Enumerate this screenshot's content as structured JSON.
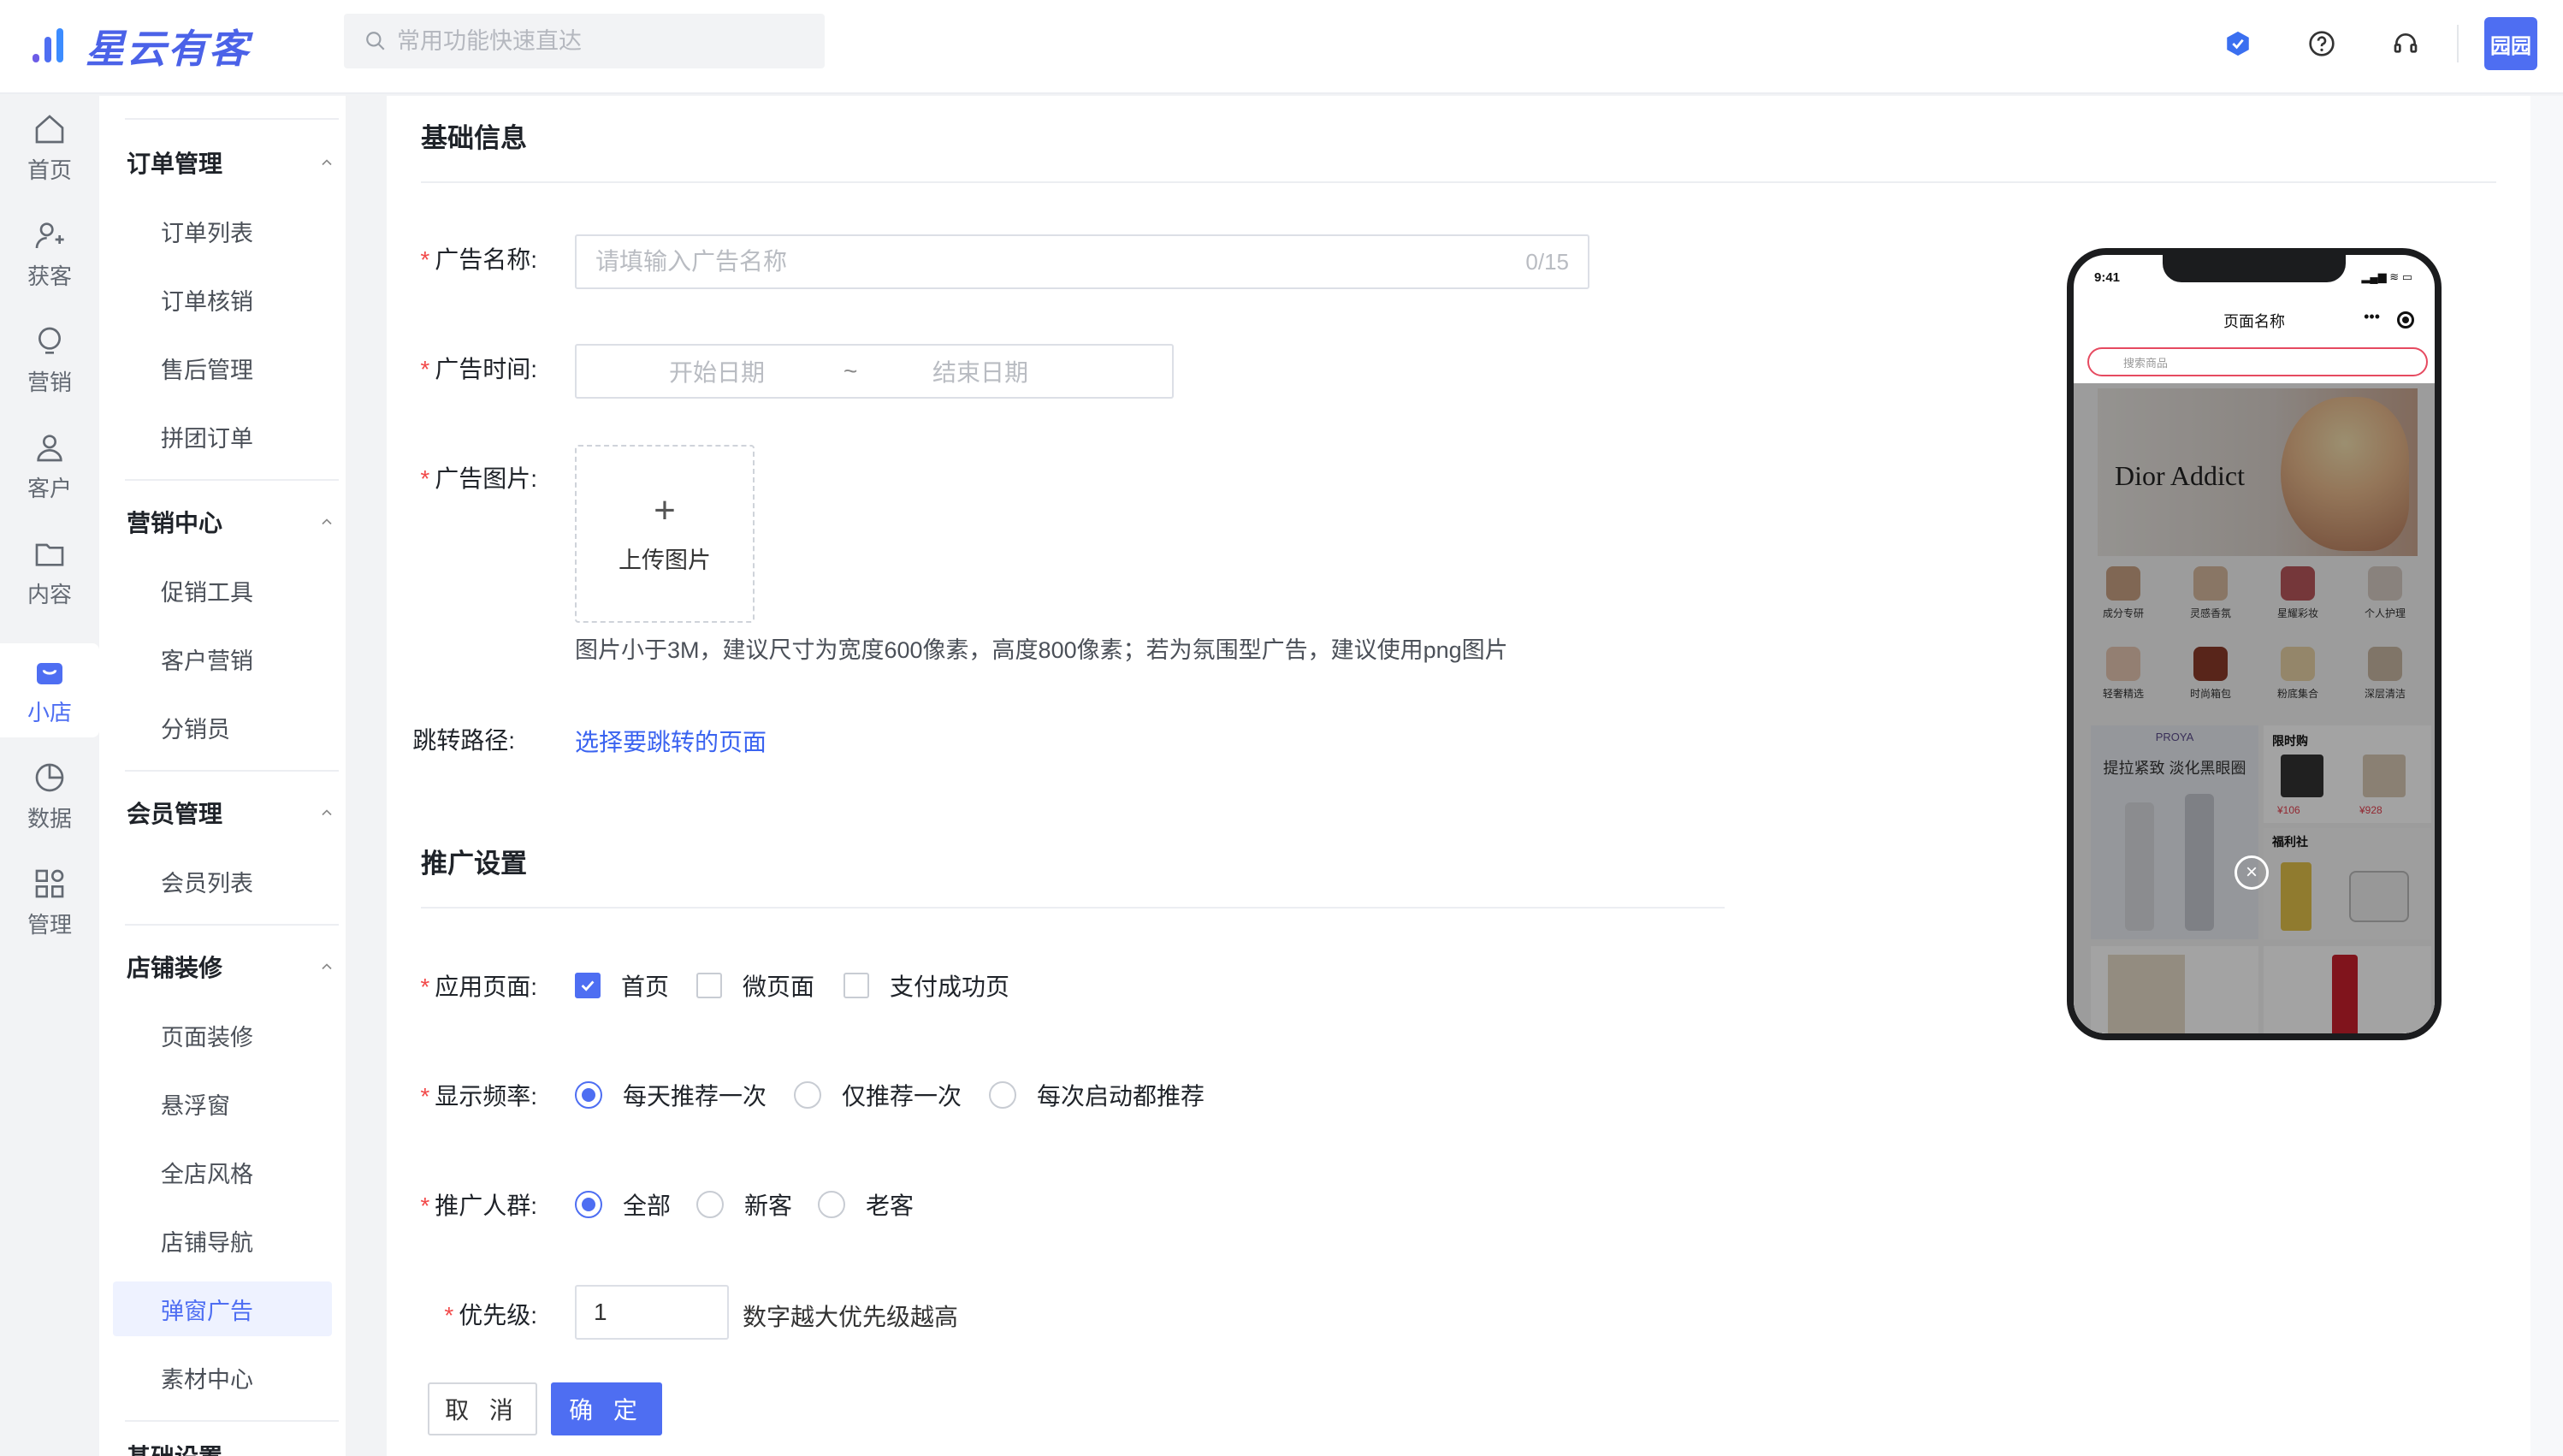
{
  "app": {
    "brand": "星云有客",
    "search_placeholder": "常用功能快速直达",
    "user_badge": "园园"
  },
  "rail": [
    {
      "label": "首页",
      "icon": "home-icon"
    },
    {
      "label": "获客",
      "icon": "user-add-icon"
    },
    {
      "label": "营销",
      "icon": "bulb-icon"
    },
    {
      "label": "客户",
      "icon": "user-icon"
    },
    {
      "label": "内容",
      "icon": "folder-icon"
    },
    {
      "label": "小店",
      "icon": "shop-icon",
      "active": true
    },
    {
      "label": "数据",
      "icon": "pie-chart-icon"
    },
    {
      "label": "管理",
      "icon": "grid-icon"
    }
  ],
  "submenu": {
    "groups": [
      {
        "title": "订单管理",
        "items": [
          "订单列表",
          "订单核销",
          "售后管理",
          "拼团订单"
        ]
      },
      {
        "title": "营销中心",
        "items": [
          "促销工具",
          "客户营销",
          "分销员"
        ]
      },
      {
        "title": "会员管理",
        "items": [
          "会员列表"
        ]
      },
      {
        "title": "店铺装修",
        "items": [
          "页面装修",
          "悬浮窗",
          "全店风格",
          "店铺导航",
          "弹窗广告",
          "素材中心"
        ]
      }
    ],
    "active_item": "弹窗广告",
    "next_group_partial": "基础设置"
  },
  "form": {
    "section_basic": "基础信息",
    "ad_name_label": "广告名称:",
    "ad_name_placeholder": "请填输入广告名称",
    "ad_name_counter": "0/15",
    "ad_time_label": "广告时间:",
    "start_date": "开始日期",
    "date_sep": "~",
    "end_date": "结束日期",
    "ad_image_label": "广告图片:",
    "upload_plus": "+",
    "upload_text": "上传图片",
    "image_hint": "图片小于3M，建议尺寸为宽度600像素，高度800像素；若为氛围型广告，建议使用png图片",
    "jump_label": "跳转路径:",
    "jump_link": "选择要跳转的页面",
    "section_promo": "推广设置",
    "apply_page_label": "应用页面:",
    "apply_pages": [
      {
        "label": "首页",
        "checked": true
      },
      {
        "label": "微页面",
        "checked": false
      },
      {
        "label": "支付成功页",
        "checked": false
      }
    ],
    "frequency_label": "显示频率:",
    "frequency_options": [
      {
        "label": "每天推荐一次",
        "selected": true
      },
      {
        "label": "仅推荐一次",
        "selected": false
      },
      {
        "label": "每次启动都推荐",
        "selected": false
      }
    ],
    "audience_label": "推广人群:",
    "audience_options": [
      {
        "label": "全部",
        "selected": true
      },
      {
        "label": "新客",
        "selected": false
      },
      {
        "label": "老客",
        "selected": false
      }
    ],
    "priority_label": "优先级:",
    "priority_value": "1",
    "priority_hint": "数字越大优先级越高",
    "cancel": "取 消",
    "confirm": "确 定"
  },
  "phone": {
    "time": "9:41",
    "status": "▂▄▆ ≋ ▭",
    "page_title": "页面名称",
    "more": "•••",
    "search_placeholder": "搜索商品",
    "banner_brand": "Dior Addict",
    "categories_row1": [
      "成分专研",
      "灵感香氛",
      "星耀彩妆",
      "个人护理"
    ],
    "categories_row2": [
      "轻奢精选",
      "时尚箱包",
      "粉底集合",
      "深层清洁"
    ],
    "promo_brand": "PROYA",
    "promo_text": "提拉紧致 淡化黑眼圈",
    "flash_title": "限时购",
    "price1": "¥106",
    "price2": "¥928",
    "welfare_title": "福利社",
    "close": "×"
  },
  "colors": {
    "accent": "#4e6ef2",
    "required": "#f24a4a",
    "link": "#3a63f0"
  }
}
